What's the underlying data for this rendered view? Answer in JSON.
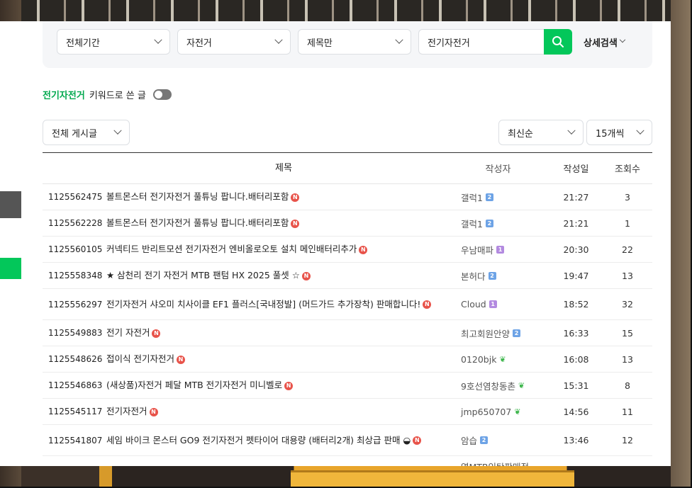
{
  "search": {
    "period": "전체기간",
    "board": "자전거",
    "scope": "제목만",
    "query": "전기자전거",
    "advanced_label": "상세검색"
  },
  "keyword_filter": {
    "keyword": "전기자전거",
    "suffix": "키워드로 쓴 글",
    "enabled": false
  },
  "filters": {
    "board_filter": "전체 게시글",
    "sort": "최신순",
    "page_size": "15개씩"
  },
  "table": {
    "headers": {
      "title": "제목",
      "author": "작성자",
      "date": "작성일",
      "views": "조회수"
    },
    "rows": [
      {
        "id": "1125562475",
        "title": "볼트몬스터 전기자전거 풀튜닝 팝니다.배터리포함",
        "new": "N",
        "author": "갤럭1",
        "level": "2",
        "level_color": "blue",
        "date": "21:27",
        "views": "3"
      },
      {
        "id": "1125562228",
        "title": "볼트몬스터 전기자전거 풀튜닝 팝니다.배터리포함",
        "new": "N",
        "author": "갤럭1",
        "level": "2",
        "level_color": "blue",
        "date": "21:21",
        "views": "1"
      },
      {
        "id": "1125560105",
        "title": "커넥티드 반리트모션 전기자전거 엔비올로오토 설치 메인배터리추가",
        "new": "N",
        "author": "우남매파",
        "level": "1",
        "level_color": "purple",
        "date": "20:30",
        "views": "22"
      },
      {
        "id": "1125558348",
        "title": "★ 삼천리 전기 자전거 MTB 팬텀 HX 2025 풀셋 ☆",
        "new": "N",
        "author": "본허다",
        "level": "2",
        "level_color": "blue",
        "date": "19:47",
        "views": "13"
      },
      {
        "id": "1125556297",
        "title": "전기자전거 샤오미 치사이클 EF1 플러스[국내정발] (머드가드 추가장착) 판매합니다!",
        "new": "N",
        "author": "Cloud",
        "level": "1",
        "level_color": "purple",
        "date": "18:52",
        "views": "32"
      },
      {
        "id": "1125549883",
        "title": "전기 자전거",
        "new": "N",
        "author": "최고회원안양",
        "level": "2",
        "level_color": "blue",
        "date": "16:33",
        "views": "15"
      },
      {
        "id": "1125548626",
        "title": "접이식 전기자전거",
        "new": "N",
        "author": "0120bjk",
        "level": "sprout",
        "level_color": "green",
        "date": "16:08",
        "views": "13"
      },
      {
        "id": "1125546863",
        "title": "(새상품)자전거 페달 MTB 전기자전거 미니벨로",
        "new": "N",
        "author": "9호선염창동촌",
        "level": "sprout",
        "level_color": "green",
        "date": "15:31",
        "views": "8"
      },
      {
        "id": "1125545117",
        "title": "전기자전거",
        "new": "N",
        "author": "jmp650707",
        "level": "sprout",
        "level_color": "green",
        "date": "14:56",
        "views": "11"
      },
      {
        "id": "1125541807",
        "title": "세임 바이크 몬스터 GO9 전기자전거 펫타이어 대용량 (배터리2개) 최상급 판매 ◒",
        "new": "N",
        "author": "암습",
        "level": "2",
        "level_color": "blue",
        "date": "13:46",
        "views": "12"
      },
      {
        "id": "",
        "title": "",
        "new": "",
        "author": "염MTB인탄판매점",
        "level": "",
        "level_color": "",
        "date": "",
        "views": ""
      }
    ]
  }
}
